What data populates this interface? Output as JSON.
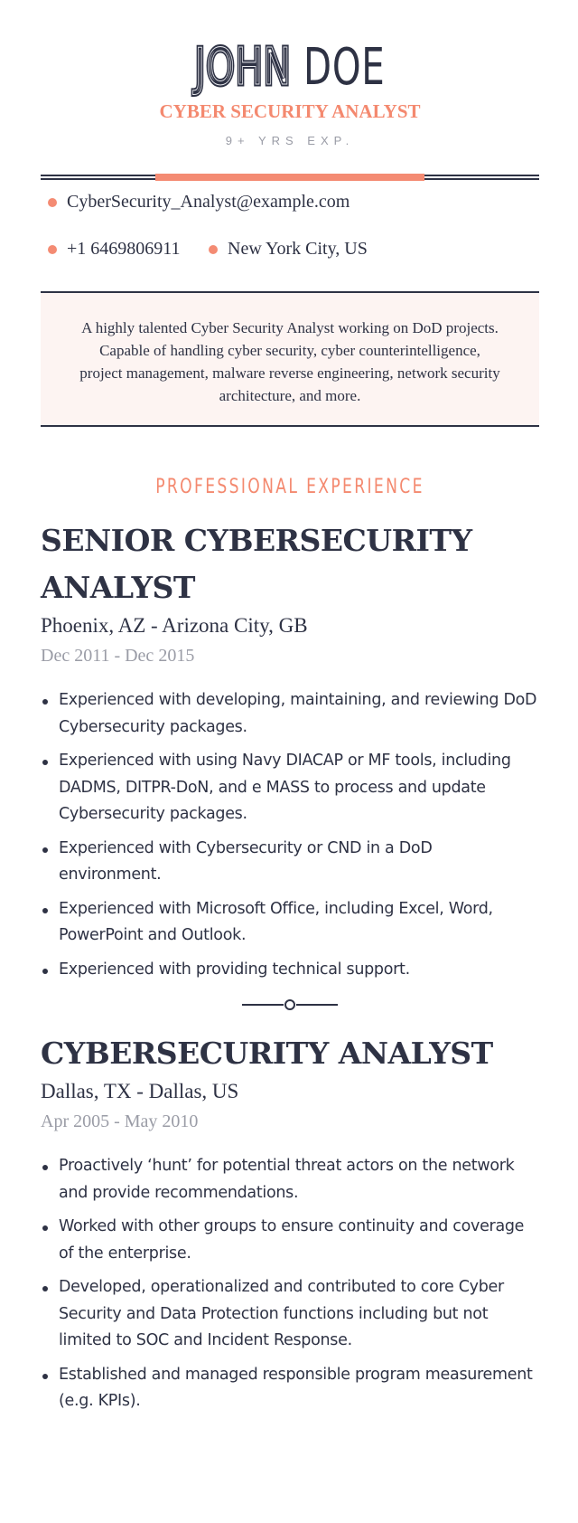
{
  "header": {
    "first_name": "JOHN",
    "last_name": "DOE",
    "title": "CYBER SECURITY ANALYST",
    "experience": "9+ YRS EXP."
  },
  "contacts": {
    "email": "CyberSecurity_Analyst@example.com",
    "phone": "+1 6469806911",
    "location": "New York City, US"
  },
  "summary": "A highly talented Cyber Security Analyst working on DoD projects. Capable of handling cyber security, cyber counterintelligence, project management, malware reverse engineering, network security architecture, and more.",
  "sections": {
    "experience_heading": "PROFESSIONAL EXPERIENCE"
  },
  "jobs": [
    {
      "title": "SENIOR CYBERSECURITY ANALYST",
      "location": "Phoenix, AZ - Arizona City, GB",
      "dates": "Dec 2011 - Dec 2015",
      "bullets": [
        "Experienced with developing, maintaining, and reviewing DoD Cybersecurity packages.",
        "Experienced with using Navy DIACAP or MF tools, including DADMS, DITPR-DoN, and e MASS to process and update Cybersecurity packages.",
        "Experienced with Cybersecurity or CND in a DoD environment.",
        "Experienced with Microsoft Office, including Excel, Word, PowerPoint and Outlook.",
        "Experienced with providing technical support."
      ]
    },
    {
      "title": "CYBERSECURITY ANALYST",
      "location": "Dallas, TX - Dallas, US",
      "dates": "Apr 2005 - May 2010",
      "bullets": [
        "Proactively ‘hunt’ for potential threat actors on the network and provide recommendations.",
        "Worked with other groups to ensure continuity and coverage of the enterprise.",
        "Developed, operationalized and contributed to core Cyber Security and Data Protection functions including but not limited to SOC and Incident Response.",
        "Established and managed responsible program measurement (e.g. KPIs)."
      ]
    }
  ],
  "colors": {
    "accent": "#f48b73",
    "text": "#2e3244",
    "muted": "#9a9ca6",
    "summary_bg": "#fdf4f2"
  }
}
